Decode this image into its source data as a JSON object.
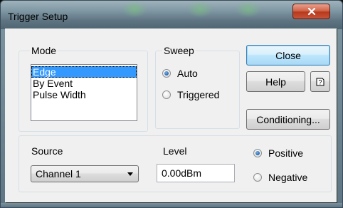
{
  "window": {
    "title": "Trigger Setup"
  },
  "mode": {
    "group_label": "Mode",
    "items": [
      "Edge",
      "By Event",
      "Pulse Width"
    ],
    "selected_index": 0
  },
  "sweep": {
    "group_label": "Sweep",
    "options": [
      {
        "label": "Auto",
        "checked": true
      },
      {
        "label": "Triggered",
        "checked": false
      }
    ]
  },
  "buttons": {
    "close": "Close",
    "help": "Help",
    "conditioning": "Conditioning..."
  },
  "source": {
    "label": "Source",
    "selected_value": "Channel 1"
  },
  "level": {
    "label": "Level",
    "value": "0.00dBm"
  },
  "polarity": {
    "options": [
      {
        "label": "Positive",
        "checked": true
      },
      {
        "label": "Negative",
        "checked": false
      }
    ]
  },
  "icons": {
    "title_close": "close-icon",
    "context_help": "context-help-icon",
    "dropdown": "chevron-down-icon"
  },
  "colors": {
    "selection": "#3399ff",
    "default_button_border": "#3c7fb1",
    "title_close_button": "#c6533a"
  }
}
